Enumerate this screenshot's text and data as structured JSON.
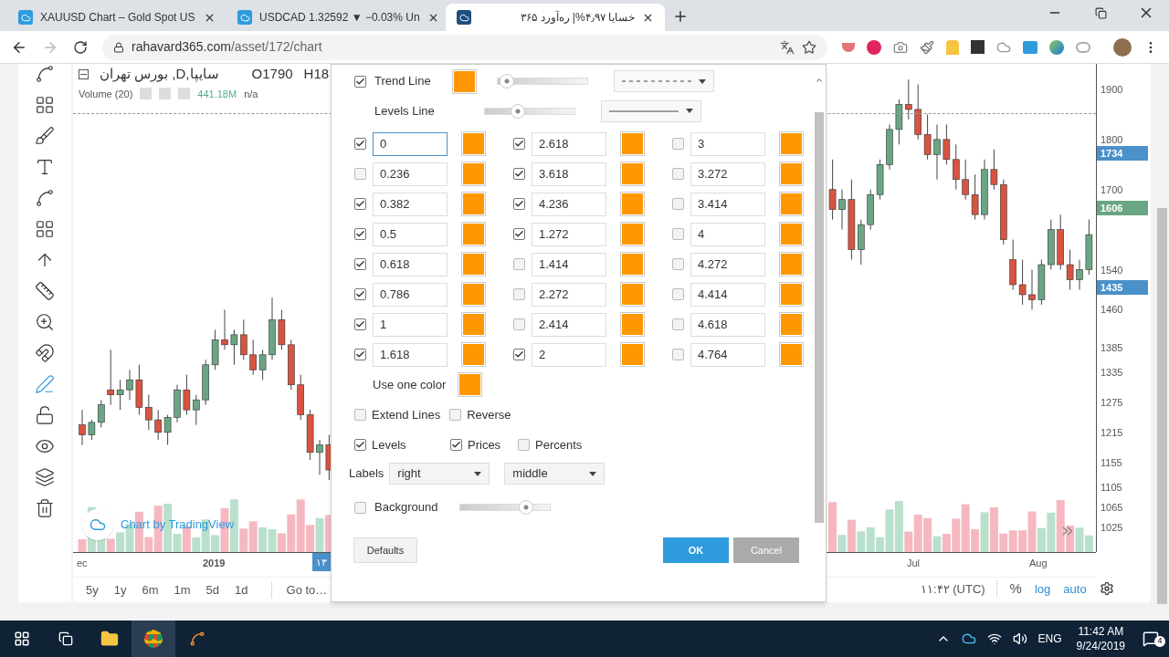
{
  "browser": {
    "tabs": [
      {
        "title": "XAUUSD Chart – Gold Spot US",
        "selected": false
      },
      {
        "title": "USDCAD 1.32592 ▼ −0.03% Un",
        "selected": false
      },
      {
        "title": "خسایا ۴٫۹۷%| ره‌آورد ۳۶۵",
        "selected": true
      }
    ],
    "url_host": "rahavard365.com",
    "url_path": "/asset/172/chart"
  },
  "chart": {
    "symbol": "سایپا,D, بورس تهران",
    "open": "O1790",
    "high": "H18",
    "volume_label": "Volume (20)",
    "volume_value": "441.18M",
    "volume_na": "n/a",
    "credit": "Chart by TradingView",
    "chart_data": {
      "type": "candlestick",
      "ohlc": [
        [
          1230,
          1260,
          1190,
          1210
        ],
        [
          1210,
          1240,
          1200,
          1235
        ],
        [
          1235,
          1280,
          1225,
          1270
        ],
        [
          1300,
          1380,
          1270,
          1290
        ],
        [
          1290,
          1320,
          1260,
          1300
        ],
        [
          1300,
          1340,
          1280,
          1320
        ],
        [
          1320,
          1350,
          1250,
          1265
        ],
        [
          1265,
          1290,
          1220,
          1240
        ],
        [
          1240,
          1260,
          1200,
          1215
        ],
        [
          1215,
          1250,
          1190,
          1245
        ],
        [
          1245,
          1310,
          1235,
          1300
        ],
        [
          1300,
          1330,
          1250,
          1260
        ],
        [
          1260,
          1290,
          1230,
          1280
        ],
        [
          1280,
          1360,
          1270,
          1350
        ],
        [
          1350,
          1420,
          1340,
          1400
        ],
        [
          1400,
          1460,
          1380,
          1390
        ],
        [
          1390,
          1420,
          1350,
          1410
        ],
        [
          1410,
          1440,
          1360,
          1370
        ],
        [
          1370,
          1400,
          1330,
          1340
        ],
        [
          1340,
          1380,
          1320,
          1370
        ],
        [
          1370,
          1484,
          1360,
          1440
        ],
        [
          1440,
          1460,
          1380,
          1390
        ],
        [
          1390,
          1400,
          1300,
          1310
        ],
        [
          1310,
          1330,
          1240,
          1250
        ],
        [
          1250,
          1260,
          1160,
          1175
        ],
        [
          1175,
          1200,
          1130,
          1190
        ],
        [
          1190,
          1210,
          1120,
          1140
        ],
        null,
        null,
        null,
        null,
        null,
        null,
        null,
        null,
        null,
        null,
        null,
        null,
        null,
        null,
        null,
        null,
        null,
        null,
        null,
        null,
        null,
        null,
        null,
        null,
        null,
        null,
        null,
        null,
        null,
        null,
        null,
        null,
        null,
        null,
        null,
        null,
        null,
        null,
        null,
        null,
        null,
        null,
        null,
        null,
        null,
        null,
        null,
        null,
        null,
        null,
        null,
        null,
        [
          1700,
          1760,
          1640,
          1660
        ],
        [
          1660,
          1700,
          1620,
          1680
        ],
        [
          1680,
          1720,
          1560,
          1580
        ],
        [
          1580,
          1640,
          1550,
          1630
        ],
        [
          1630,
          1700,
          1620,
          1690
        ],
        [
          1690,
          1760,
          1680,
          1750
        ],
        [
          1750,
          1830,
          1740,
          1820
        ],
        [
          1820,
          1880,
          1790,
          1870
        ],
        [
          1870,
          1920,
          1840,
          1860
        ],
        [
          1860,
          1910,
          1800,
          1810
        ],
        [
          1810,
          1850,
          1760,
          1770
        ],
        [
          1770,
          1830,
          1720,
          1800
        ],
        [
          1800,
          1830,
          1750,
          1760
        ],
        [
          1760,
          1790,
          1700,
          1720
        ],
        [
          1720,
          1760,
          1680,
          1690
        ],
        [
          1690,
          1730,
          1640,
          1650
        ],
        [
          1650,
          1760,
          1640,
          1740
        ],
        [
          1740,
          1780,
          1700,
          1710
        ],
        [
          1710,
          1720,
          1590,
          1600
        ],
        [
          1560,
          1600,
          1500,
          1510
        ],
        [
          1510,
          1560,
          1470,
          1490
        ],
        [
          1490,
          1540,
          1460,
          1480
        ],
        [
          1480,
          1560,
          1470,
          1550
        ],
        [
          1550,
          1640,
          1540,
          1620
        ],
        [
          1620,
          1650,
          1540,
          1550
        ],
        [
          1550,
          1580,
          1500,
          1520
        ],
        [
          1520,
          1560,
          1500,
          1540
        ],
        [
          1540,
          1640,
          1530,
          1610
        ]
      ],
      "ylim": [
        976,
        1951
      ],
      "yticks": [
        1900,
        1800,
        1700,
        1540,
        1460,
        1385,
        1335,
        1275,
        1215,
        1155,
        1105,
        1065,
        1025
      ]
    },
    "price_badges": [
      {
        "text": "1734",
        "kind": "blue"
      },
      {
        "text": "1606",
        "kind": "green"
      },
      {
        "text": "1435",
        "kind": "blue"
      }
    ],
    "time_labels": [
      {
        "text": "ec",
        "kind": "tick"
      },
      {
        "text": "2019",
        "kind": "bold"
      },
      {
        "text": "۱۳",
        "kind": "cursor"
      },
      {
        "text": "Jul",
        "kind": "tick"
      },
      {
        "text": "Aug",
        "kind": "tick"
      }
    ],
    "ranges": [
      "5y",
      "1y",
      "6m",
      "1m",
      "5d",
      "1d"
    ],
    "goto": "Go to…",
    "clock": "۱۱:۴۲ (UTC)",
    "percent": "%",
    "log": "log",
    "auto": "auto"
  },
  "dialog": {
    "trend_line": {
      "label": "Trend Line",
      "checked": true,
      "level": 0.02,
      "dashed": true
    },
    "levels_line": {
      "label": "Levels Line",
      "level": 0.34,
      "dashed": false
    },
    "levels": [
      [
        {
          "value": "0",
          "checked": true,
          "focused": true
        },
        {
          "value": "0.236",
          "checked": false,
          "focused": false
        },
        {
          "value": "0.382",
          "checked": true,
          "focused": false
        },
        {
          "value": "0.5",
          "checked": true,
          "focused": false
        },
        {
          "value": "0.618",
          "checked": true,
          "focused": false
        },
        {
          "value": "0.786",
          "checked": true,
          "focused": false
        },
        {
          "value": "1",
          "checked": true,
          "focused": false
        },
        {
          "value": "1.618",
          "checked": true,
          "focused": false
        }
      ],
      [
        {
          "value": "2.618",
          "checked": true,
          "focused": false
        },
        {
          "value": "3.618",
          "checked": true,
          "focused": false
        },
        {
          "value": "4.236",
          "checked": true,
          "focused": false
        },
        {
          "value": "1.272",
          "checked": true,
          "focused": false
        },
        {
          "value": "1.414",
          "checked": false,
          "focused": false
        },
        {
          "value": "2.272",
          "checked": false,
          "focused": false
        },
        {
          "value": "2.414",
          "checked": false,
          "focused": false
        },
        {
          "value": "2",
          "checked": true,
          "focused": false
        }
      ],
      [
        {
          "value": "3",
          "checked": false,
          "focused": false
        },
        {
          "value": "3.272",
          "checked": false,
          "focused": false
        },
        {
          "value": "3.414",
          "checked": false,
          "focused": false
        },
        {
          "value": "4",
          "checked": false,
          "focused": false
        },
        {
          "value": "4.272",
          "checked": false,
          "focused": false
        },
        {
          "value": "4.414",
          "checked": false,
          "focused": false
        },
        {
          "value": "4.618",
          "checked": false,
          "focused": false
        },
        {
          "value": "4.764",
          "checked": false,
          "focused": false
        }
      ]
    ],
    "one_color": "Use one color",
    "options_a": [
      {
        "label": "Extend Lines",
        "checked": false
      },
      {
        "label": "Reverse",
        "checked": false
      }
    ],
    "options_b": [
      {
        "label": "Levels",
        "checked": true
      },
      {
        "label": "Prices",
        "checked": true
      },
      {
        "label": "Percents",
        "checked": false
      }
    ],
    "labels": {
      "label": "Labels",
      "horizontal": "right",
      "vertical": "middle"
    },
    "background": {
      "label": "Background",
      "checked": false,
      "level": 0.78
    },
    "buttons": [
      {
        "label": "Defaults",
        "kind": "plain"
      },
      {
        "label": "OK",
        "kind": "primary"
      },
      {
        "label": "Cancel",
        "kind": "muted"
      }
    ]
  },
  "taskbar": {
    "language": "ENG",
    "time": "11:42 AM",
    "date": "9/24/2019",
    "notifications": "4"
  }
}
